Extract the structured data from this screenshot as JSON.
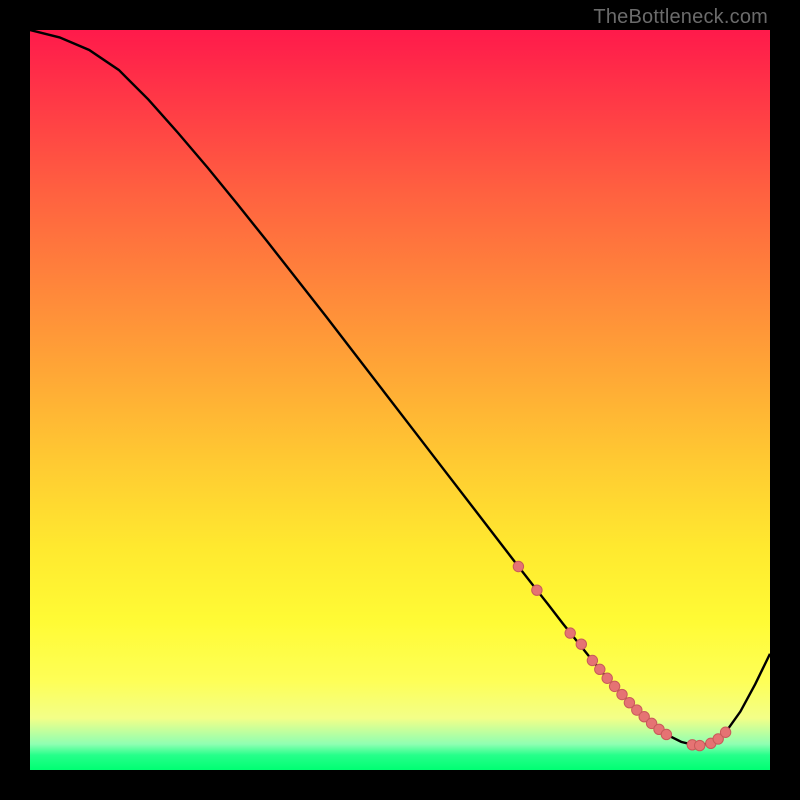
{
  "attribution": "TheBottleneck.com",
  "colors": {
    "frame": "#000000",
    "curve": "#000000",
    "dot_fill": "#e57373",
    "dot_stroke": "#c85a5a",
    "gradient_stops": [
      "#ff1a4b",
      "#ff3a46",
      "#ff6140",
      "#ff843b",
      "#ffa636",
      "#ffc932",
      "#ffe92f",
      "#fffb35",
      "#feff57",
      "#f3ff88",
      "#8fffb2",
      "#26ff8a",
      "#00ff73"
    ]
  },
  "chart_data": {
    "type": "line",
    "title": "",
    "xlabel": "",
    "ylabel": "",
    "xlim": [
      0,
      100
    ],
    "ylim": [
      0,
      100
    ],
    "grid": false,
    "legend": false,
    "series": [
      {
        "name": "bottleneck-curve",
        "x": [
          0,
          4,
          8,
          12,
          16,
          20,
          24,
          28,
          32,
          36,
          40,
          44,
          48,
          52,
          56,
          60,
          64,
          66,
          68.5,
          70,
          72,
          74,
          76,
          78,
          80,
          82,
          84,
          86,
          88,
          90,
          92,
          94,
          96,
          98,
          100
        ],
        "y": [
          100,
          99,
          97.3,
          94.6,
          90.6,
          86.1,
          81.4,
          76.5,
          71.5,
          66.4,
          61.3,
          56.1,
          50.9,
          45.7,
          40.5,
          35.3,
          30.1,
          27.5,
          24.3,
          22.4,
          19.8,
          17.3,
          14.8,
          12.4,
          10.2,
          8.1,
          6.3,
          4.8,
          3.8,
          3.3,
          3.6,
          5.1,
          7.9,
          11.6,
          15.7
        ]
      }
    ],
    "markers": [
      {
        "name": "highlight-dots",
        "x": [
          66,
          68.5,
          73,
          74.5,
          76,
          77,
          78,
          79,
          80,
          81,
          82,
          83,
          84,
          85,
          86,
          89.5,
          90.5,
          92,
          93,
          94
        ],
        "y": [
          27.5,
          24.3,
          18.5,
          17.0,
          14.8,
          13.6,
          12.4,
          11.3,
          10.2,
          9.1,
          8.1,
          7.2,
          6.3,
          5.5,
          4.8,
          3.4,
          3.3,
          3.6,
          4.2,
          5.1
        ]
      }
    ]
  }
}
